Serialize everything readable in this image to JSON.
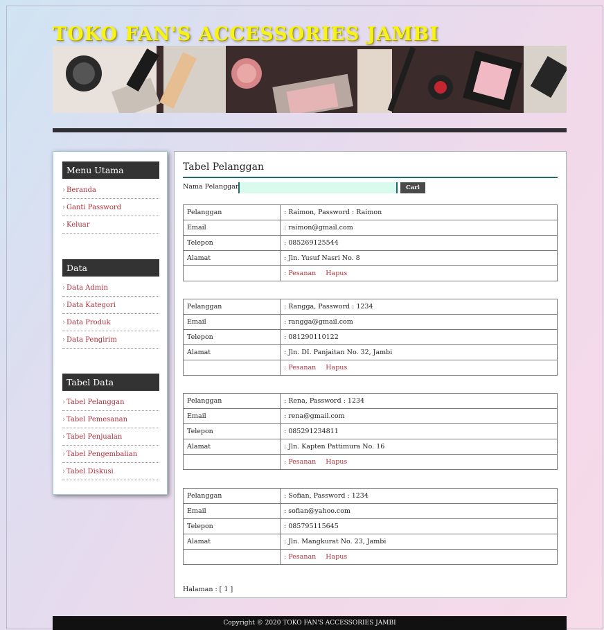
{
  "site": {
    "title": "TOKO FAN'S ACCESSORIES JAMBI"
  },
  "sidebar": {
    "sections": [
      {
        "heading": "Menu Utama",
        "items": [
          "Beranda",
          "Ganti Password",
          "Keluar"
        ]
      },
      {
        "heading": "Data",
        "items": [
          "Data Admin",
          "Data Kategori",
          "Data Produk",
          "Data Pengirim"
        ]
      },
      {
        "heading": "Tabel Data",
        "items": [
          "Tabel Pelanggan",
          "Tabel Pemesanan",
          "Tabel Penjualan",
          "Tabel Pengembalian",
          "Tabel Diskusi"
        ]
      }
    ],
    "arrow": "›"
  },
  "main": {
    "title": "Tabel Pelanggan",
    "search": {
      "label": "Nama Pelanggan :",
      "value": "",
      "button": "Cari"
    },
    "field_labels": {
      "pelanggan": "Pelanggan",
      "email": "Email",
      "telepon": "Telepon",
      "alamat": "Alamat"
    },
    "action_labels": {
      "pesanan": ": Pesanan",
      "hapus": "Hapus"
    },
    "records": [
      {
        "pelanggan": ": Raimon, Password : Raimon",
        "email": ": raimon@gmail.com",
        "telepon": ": 085269125544",
        "alamat": ": Jln. Yusuf Nasri No. 8"
      },
      {
        "pelanggan": ": Rangga, Password : 1234",
        "email": ": rangga@gmail.com",
        "telepon": ": 081290110122",
        "alamat": ": Jln. DI. Panjaitan No. 32, Jambi"
      },
      {
        "pelanggan": ": Rena, Password : 1234",
        "email": ": rena@gmail.com",
        "telepon": ": 085291234811",
        "alamat": ": Jln. Kapten Pattimura No. 16"
      },
      {
        "pelanggan": ": Sofian, Password : 1234",
        "email": ": sofian@yahoo.com",
        "telepon": ": 085795115645",
        "alamat": ": Jln. Mangkurat No. 23, Jambi"
      }
    ],
    "pagination": "Halaman : [ 1 ]"
  },
  "footer": {
    "copyright": "Copyright © 2020 TOKO FAN'S ACCESSORIES JAMBI"
  },
  "colors": {
    "title": "#f6f21a",
    "link": "#b0303a",
    "accent": "#1f6a6e",
    "sidebar_head": "#333333"
  }
}
